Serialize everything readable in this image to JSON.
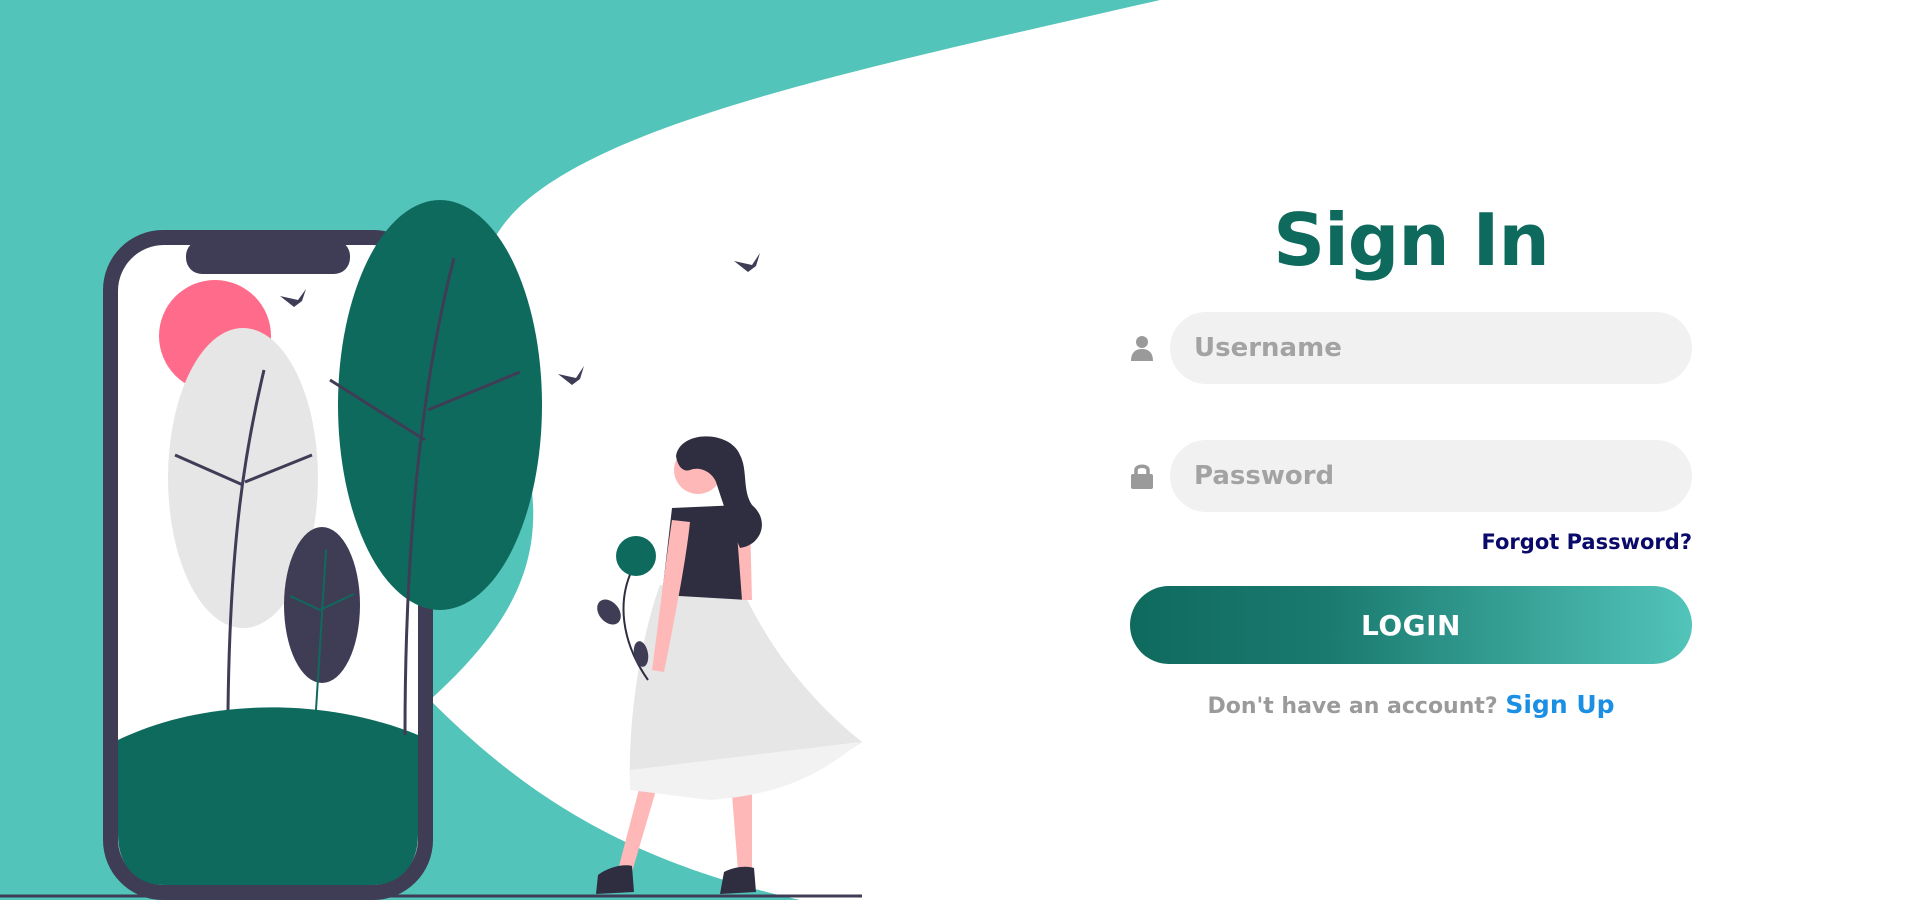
{
  "colors": {
    "teal_background": "#52c4ba",
    "dark_green": "#0f6a5e",
    "title_color": "#0f6a5e",
    "input_background": "#f1f1f1",
    "placeholder_color": "#a3a3a3",
    "forgot_link_color": "#0a0a6b",
    "signup_link_color": "#1a8fe3",
    "muted_text": "#9a9a9a",
    "sun_color": "#ff6b8a",
    "phone_frame": "#3f3d56"
  },
  "form": {
    "title": "Sign In",
    "username": {
      "icon": "user-icon",
      "placeholder": "Username",
      "value": ""
    },
    "password": {
      "icon": "lock-icon",
      "placeholder": "Password",
      "value": ""
    },
    "forgot_password_label": "Forgot Password?",
    "login_label": "LOGIN",
    "signup_prompt": "Don't have an account?",
    "signup_label": "Sign Up"
  },
  "illustration": {
    "icons": [
      "phone-illustration",
      "tree-icon",
      "sun-icon",
      "bird-icon",
      "woman-with-flower-illustration"
    ]
  }
}
